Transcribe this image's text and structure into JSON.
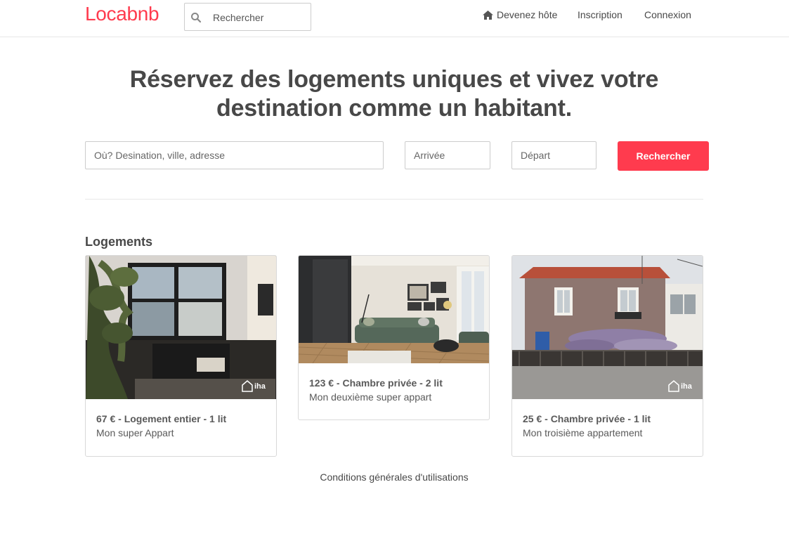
{
  "navbar": {
    "brand": "Locabnb",
    "search_placeholder": "Rechercher",
    "links": {
      "host": "Devenez hôte",
      "signup": "Inscription",
      "login": "Connexion"
    }
  },
  "hero": {
    "title": "Réservez des logements uniques et vivez votre destination comme un habitant."
  },
  "search_form": {
    "destination_placeholder": "Où? Desination, ville, adresse",
    "arrival_placeholder": "Arrivée",
    "departure_placeholder": "Départ",
    "submit_label": "Rechercher"
  },
  "listings": {
    "title": "Logements",
    "items": [
      {
        "price_line": "67 € - Logement entier - 1 lit",
        "name": "Mon super Appart",
        "badge": "iha"
      },
      {
        "price_line": "123 € - Chambre privée - 2 lit",
        "name": "Mon deuxième super appart",
        "badge": ""
      },
      {
        "price_line": "25 € - Chambre privée - 1 lit",
        "name": "Mon troisième appartement",
        "badge": "iha"
      }
    ]
  },
  "footer": {
    "terms_link": "Conditions générales d'utilisations"
  },
  "colors": {
    "accent": "#ff3b4e",
    "text": "#484848",
    "border": "#cccccc"
  },
  "icons": {
    "nav_search": "search-icon",
    "host_link": "home-icon"
  }
}
